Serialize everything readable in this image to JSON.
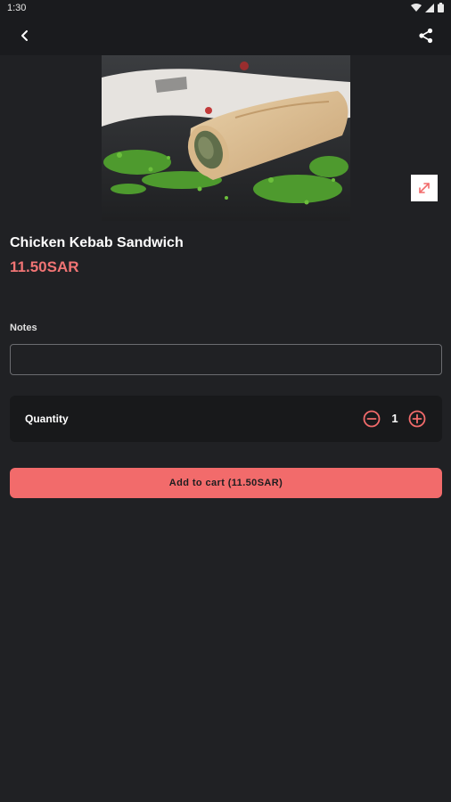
{
  "status_bar": {
    "time": "1:30",
    "icons": [
      "wifi-icon",
      "signal-icon",
      "battery-icon"
    ]
  },
  "app_bar": {
    "back_icon": "back-arrow-icon",
    "share_icon": "share-icon"
  },
  "product": {
    "name": "Chicken Kebab Sandwich",
    "price": "11.50SAR",
    "image_alt": "food-photo"
  },
  "notes": {
    "label": "Notes",
    "value": "",
    "placeholder": ""
  },
  "quantity": {
    "label": "Quantity",
    "value": "1"
  },
  "cart": {
    "button_label": "Add to cart (11.50SAR)"
  },
  "colors": {
    "background": "#202124",
    "accent": "#f26b6b",
    "price": "#f07474"
  }
}
